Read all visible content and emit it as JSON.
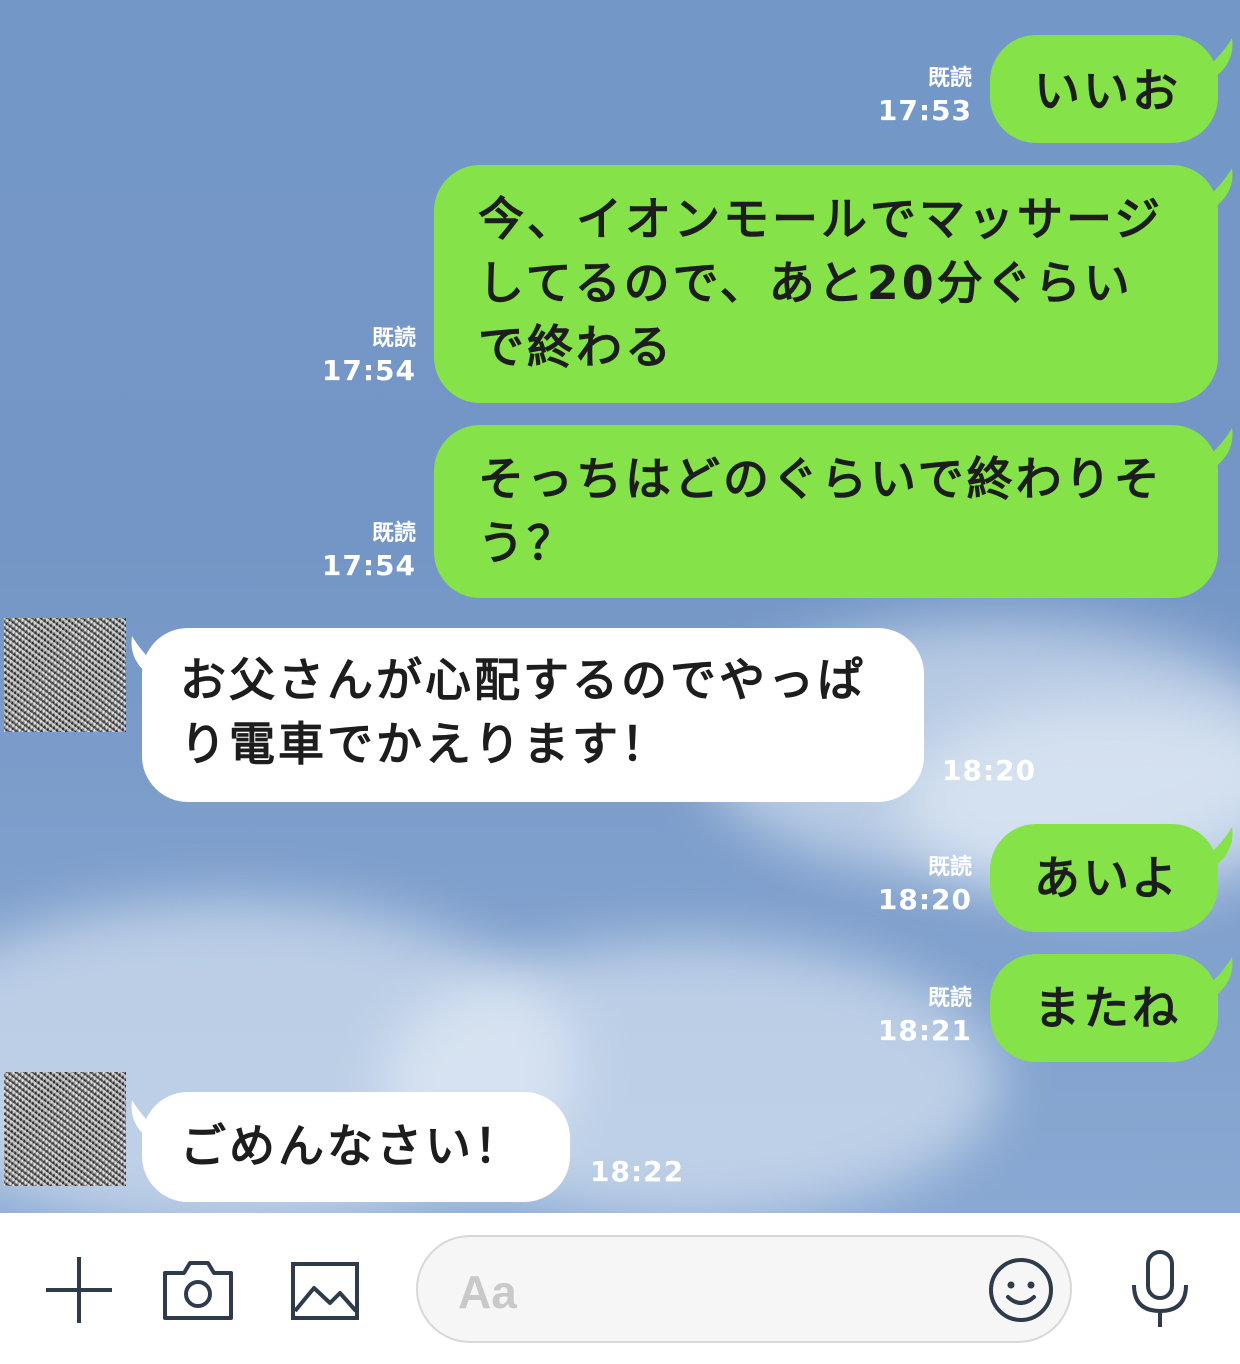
{
  "messages": [
    {
      "side": "me",
      "text": "いいお",
      "read": "既読",
      "time": "17:53"
    },
    {
      "side": "me",
      "lines": [
        "今、イオンモールでマッサージ",
        "してるので、あと20分ぐらい",
        "で終わる"
      ],
      "read": "既読",
      "time": "17:54"
    },
    {
      "side": "me",
      "lines": [
        "そっちはどのぐらいで終わりそ",
        "う？"
      ],
      "read": "既読",
      "time": "17:54"
    },
    {
      "side": "them",
      "lines": [
        "お父さんが心配するのでやっぱ",
        "り電車でかえります！"
      ],
      "time": "18:20"
    },
    {
      "side": "me",
      "text": "あいよ",
      "read": "既読",
      "time": "18:20"
    },
    {
      "side": "me",
      "text": "またね",
      "read": "既読",
      "time": "18:21"
    },
    {
      "side": "them",
      "text": "ごめんなさい！",
      "time": "18:22"
    }
  ],
  "input_bar": {
    "placeholder": "Aa",
    "icons": [
      "plus-icon",
      "camera-icon",
      "image-icon",
      "emoji-icon",
      "microphone-icon"
    ]
  },
  "colors": {
    "outgoing_bubble": "#85e249",
    "incoming_bubble": "#ffffff",
    "background": "#7496c6",
    "icon": "#2f3b4b"
  }
}
